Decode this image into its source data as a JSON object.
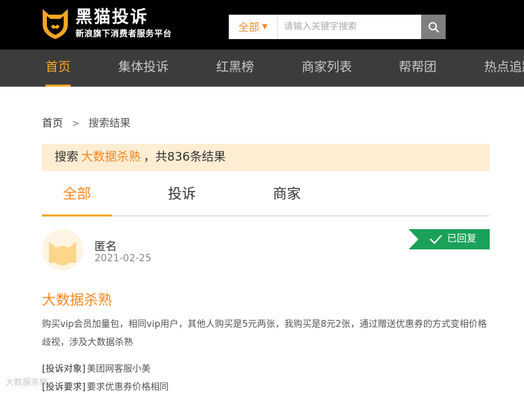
{
  "header": {
    "logo_title": "黑猫投诉",
    "logo_subtitle": "新浪旗下消费者服务平台",
    "search": {
      "scope": "全部",
      "placeholder": "请输入关键字搜索",
      "value": ""
    }
  },
  "nav": {
    "items": [
      {
        "label": "首页",
        "active": true
      },
      {
        "label": "集体投诉"
      },
      {
        "label": "红黑榜"
      },
      {
        "label": "商家列表"
      },
      {
        "label": "帮帮团"
      },
      {
        "label": "热点追踪"
      }
    ]
  },
  "breadcrumb": {
    "home": "首页",
    "separator": ">",
    "current": "搜索结果"
  },
  "result_summary": {
    "prefix": "搜索",
    "keyword": "大数据杀熟",
    "suffix": "，共836条结果"
  },
  "tabs": [
    {
      "label": "全部",
      "active": true
    },
    {
      "label": "投诉"
    },
    {
      "label": "商家"
    }
  ],
  "complaint": {
    "user": "匿名",
    "date": "2021-02-25",
    "status": "已回复",
    "title": "大数据杀熟",
    "body": "购买vip会员加量包，相同vip用户，其他人购买是5元两张，我购买是8元2张，通过赠送优惠券的方式变相价格歧视，涉及大数据杀熟",
    "target_label": "[投诉对象]",
    "target_value": "美团网客服小美",
    "request_label": "[投诉要求]",
    "request_value": "要求优惠券价格相同"
  },
  "watermark": "大数据杀熟",
  "colors": {
    "accent_orange": "#f5871f",
    "status_green": "#1aa15a",
    "nav_bg": "#3c3c3c",
    "header_bg": "#000000",
    "banner_bg": "#fdedd3"
  }
}
